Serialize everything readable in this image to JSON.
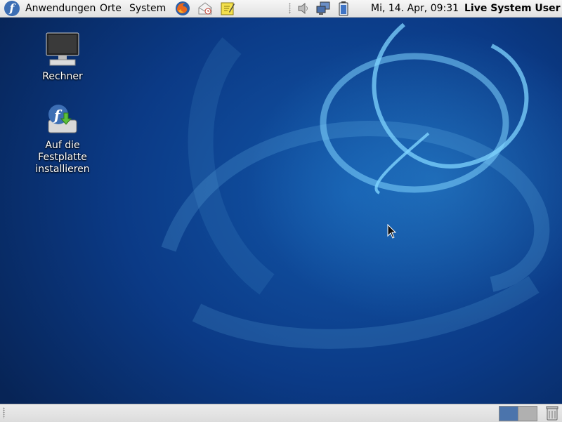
{
  "top_panel": {
    "menus": {
      "applications": "Anwendungen",
      "places": "Orte",
      "system": "System"
    },
    "launchers": [
      "firefox-icon",
      "mail-icon",
      "notes-icon"
    ],
    "tray_icons": [
      "volume-icon",
      "network-icon",
      "battery-icon"
    ],
    "clock": "Mi, 14. Apr, 09:31",
    "user": "Live System User"
  },
  "desktop": {
    "icons": [
      {
        "label": "Rechner",
        "icon": "computer-icon"
      },
      {
        "label": "Auf die Festplatte installieren",
        "icon": "install-to-disk-icon"
      }
    ]
  },
  "bottom_panel": {
    "workspaces": [
      "workspace-1",
      "workspace-2"
    ],
    "active_workspace": "workspace-1",
    "trash": "trash-icon"
  },
  "colors": {
    "panel": "#e6e6e6",
    "desktop_dark": "#072456",
    "desktop_mid": "#1256a8",
    "swirl": "#7fd4ff",
    "workspace_active": "#4b74ac",
    "workspace_inactive": "#b0b0b0",
    "fedora_blue": "#3c6eb4"
  }
}
